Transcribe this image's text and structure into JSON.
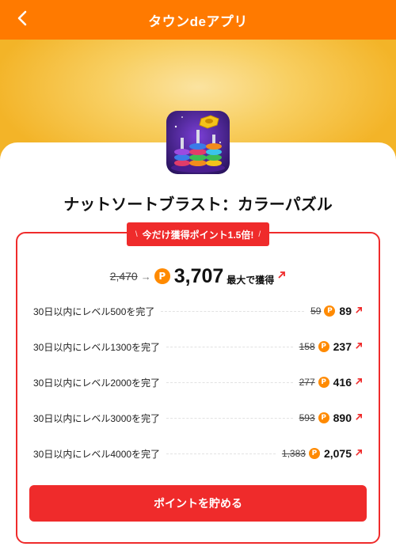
{
  "header": {
    "title": "タウンdeアプリ",
    "back_icon": "chevron-left-icon",
    "background": "#ff7a00"
  },
  "app": {
    "name": "ナットソートブラスト：カラーパズル",
    "icon": "nut-sort-game-icon"
  },
  "promo": {
    "badge_text": "今だけ獲得ポイント1.5倍!",
    "deco_left": "\\",
    "deco_right": "/",
    "accent_color": "#ef2b2b"
  },
  "total": {
    "old_points": "2,470",
    "arrow": "→",
    "coin_symbol": "P",
    "new_points": "3,707",
    "max_label": "最大で獲得"
  },
  "tasks": [
    {
      "label": "30日以内にレベル500を完了",
      "old": "59",
      "new": "89"
    },
    {
      "label": "30日以内にレベル1300を完了",
      "old": "158",
      "new": "237"
    },
    {
      "label": "30日以内にレベル2000を完了",
      "old": "277",
      "new": "416"
    },
    {
      "label": "30日以内にレベル3000を完了",
      "old": "593",
      "new": "890"
    },
    {
      "label": "30日以内にレベル4000を完了",
      "old": "1,383",
      "new": "2,075"
    }
  ],
  "cta": {
    "label": "ポイントを貯める"
  },
  "coin_color": "#ff8a00"
}
